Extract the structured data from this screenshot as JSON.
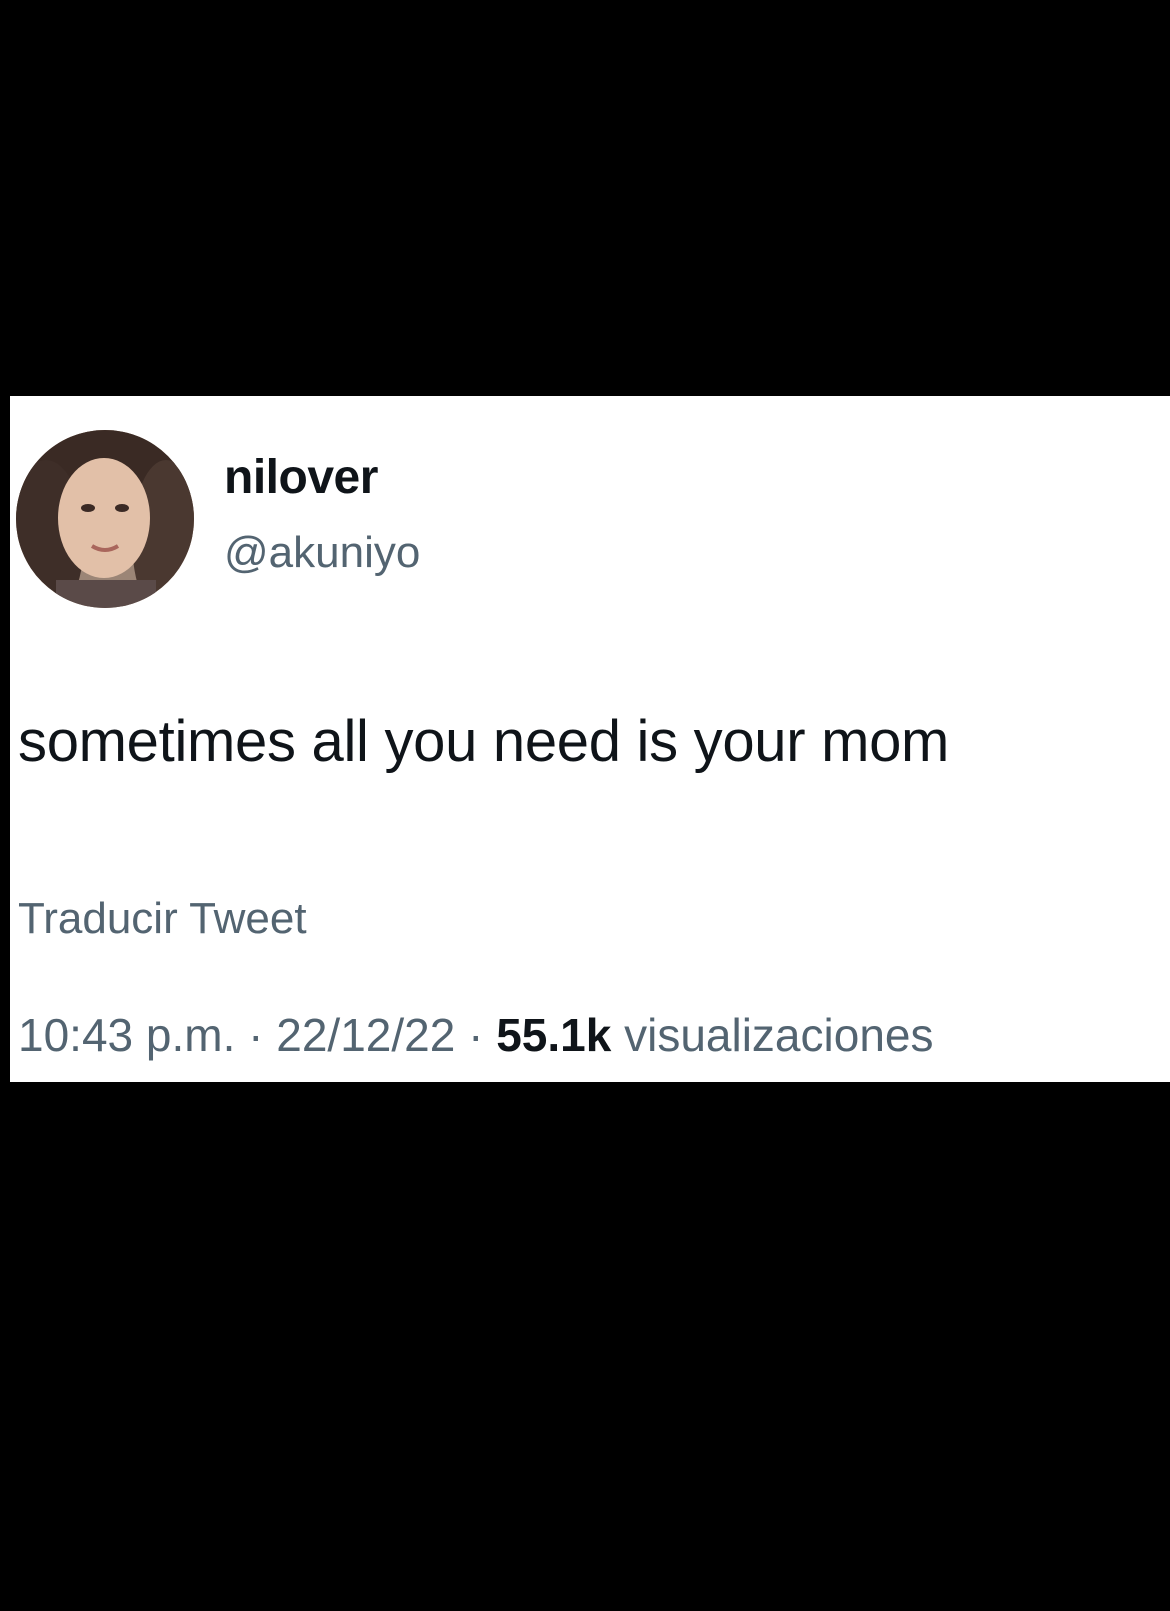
{
  "tweet": {
    "display_name": "nilover",
    "handle": "@akuniyo",
    "text": "sometimes all you need is your mom",
    "translate_label": "Traducir Tweet",
    "time": "10:43 p.m.",
    "separator": " · ",
    "date": "22/12/22",
    "views_count": "55.1k",
    "views_label": " visualizaciones"
  },
  "colors": {
    "background": "#000000",
    "card": "#ffffff",
    "primary_text": "#0f1419",
    "secondary_text": "#536471"
  },
  "icons": {
    "avatar": "profile-photo"
  }
}
